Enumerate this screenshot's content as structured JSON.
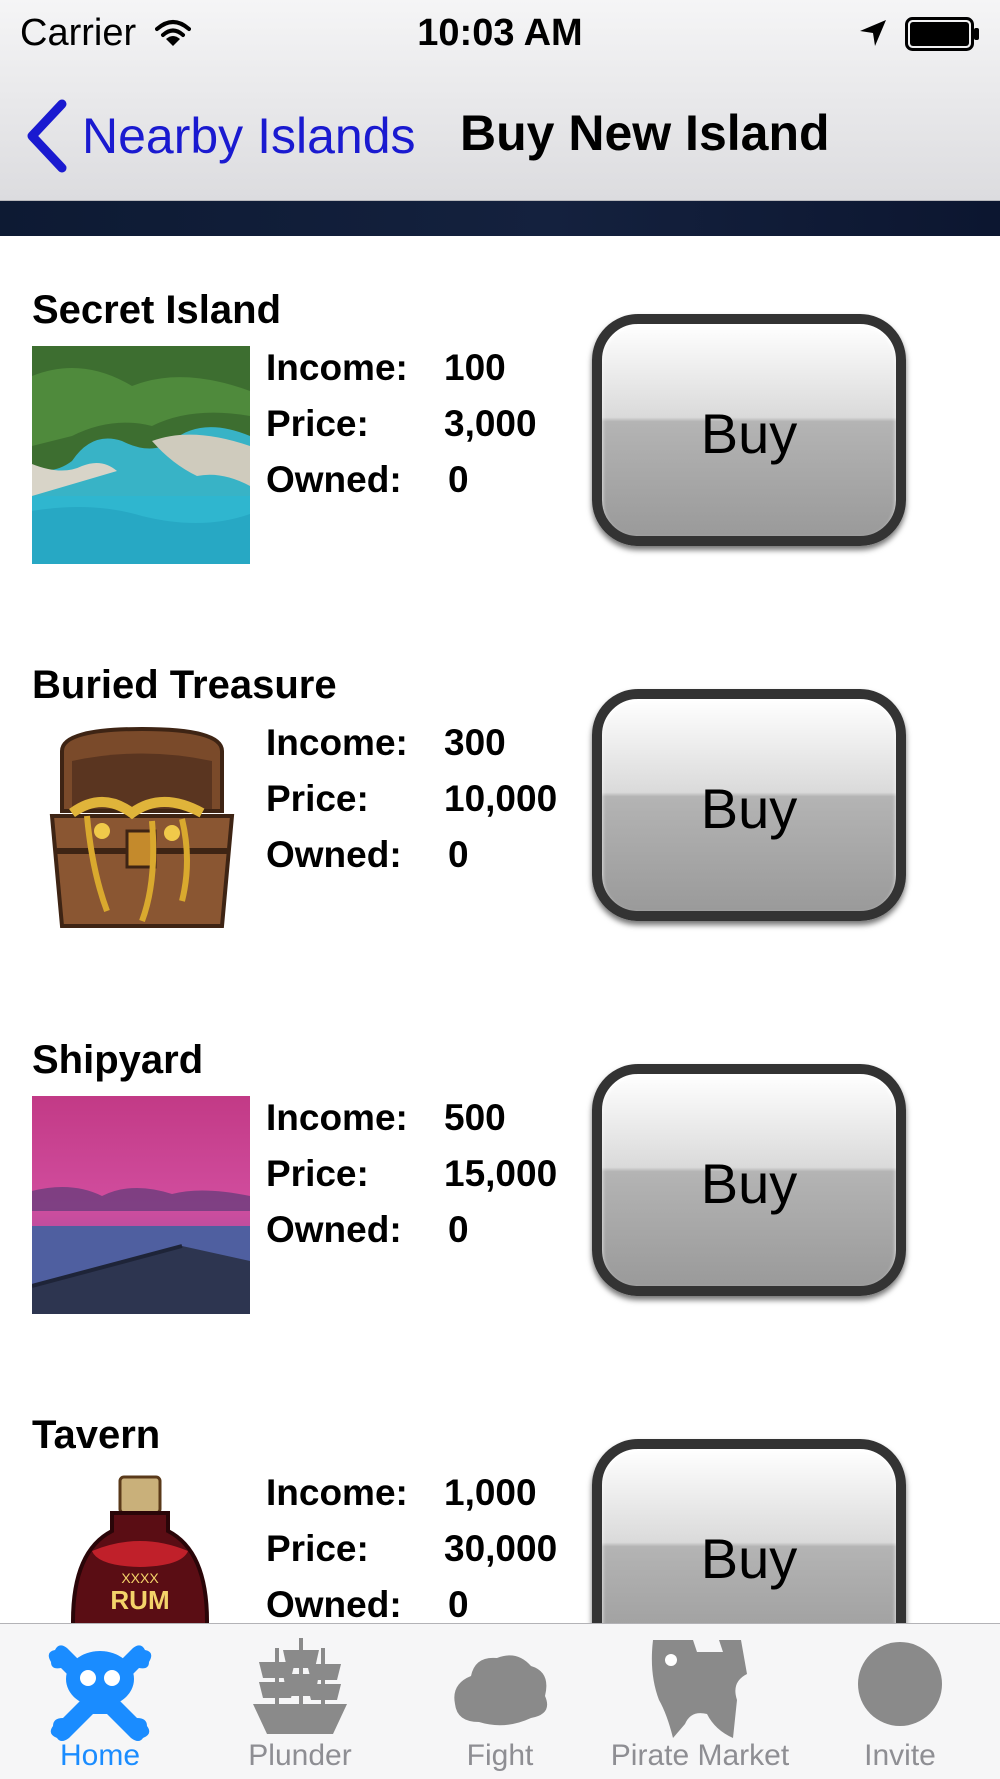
{
  "status_bar": {
    "carrier": "Carrier",
    "time": "10:03 AM"
  },
  "nav": {
    "back_label": "Nearby Islands",
    "title": "Buy New Island"
  },
  "stat_labels": {
    "income": "Income:",
    "price": "Price:",
    "owned": "Owned:"
  },
  "items": [
    {
      "name": "Secret Island",
      "income": "100",
      "price": "3,000",
      "owned": "0",
      "buy_label": "Buy",
      "thumbnail": "tropical-island-photo"
    },
    {
      "name": "Buried Treasure",
      "income": "300",
      "price": "10,000",
      "owned": "0",
      "buy_label": "Buy",
      "thumbnail": "treasure-chest-photo"
    },
    {
      "name": "Shipyard",
      "income": "500",
      "price": "15,000",
      "owned": "0",
      "buy_label": "Buy",
      "thumbnail": "purple-sunset-dock-photo"
    },
    {
      "name": "Tavern",
      "income": "1,000",
      "price": "30,000",
      "owned": "0",
      "buy_label": "Buy",
      "thumbnail": "rum-bottle-photo"
    }
  ],
  "tabs": [
    {
      "label": "Home",
      "icon": "skull-crossbones-icon",
      "active": true
    },
    {
      "label": "Plunder",
      "icon": "pirate-ship-icon",
      "active": false
    },
    {
      "label": "Fight",
      "icon": "island-icon",
      "active": false
    },
    {
      "label": "Pirate Market",
      "icon": "pirate-market-icon",
      "active": false
    },
    {
      "label": "Invite",
      "icon": "invite-circle-icon",
      "active": false
    }
  ],
  "colors": {
    "link": "#1a1ad0",
    "tab_active": "#1a8cff",
    "tab_inactive": "#8e8e93"
  }
}
